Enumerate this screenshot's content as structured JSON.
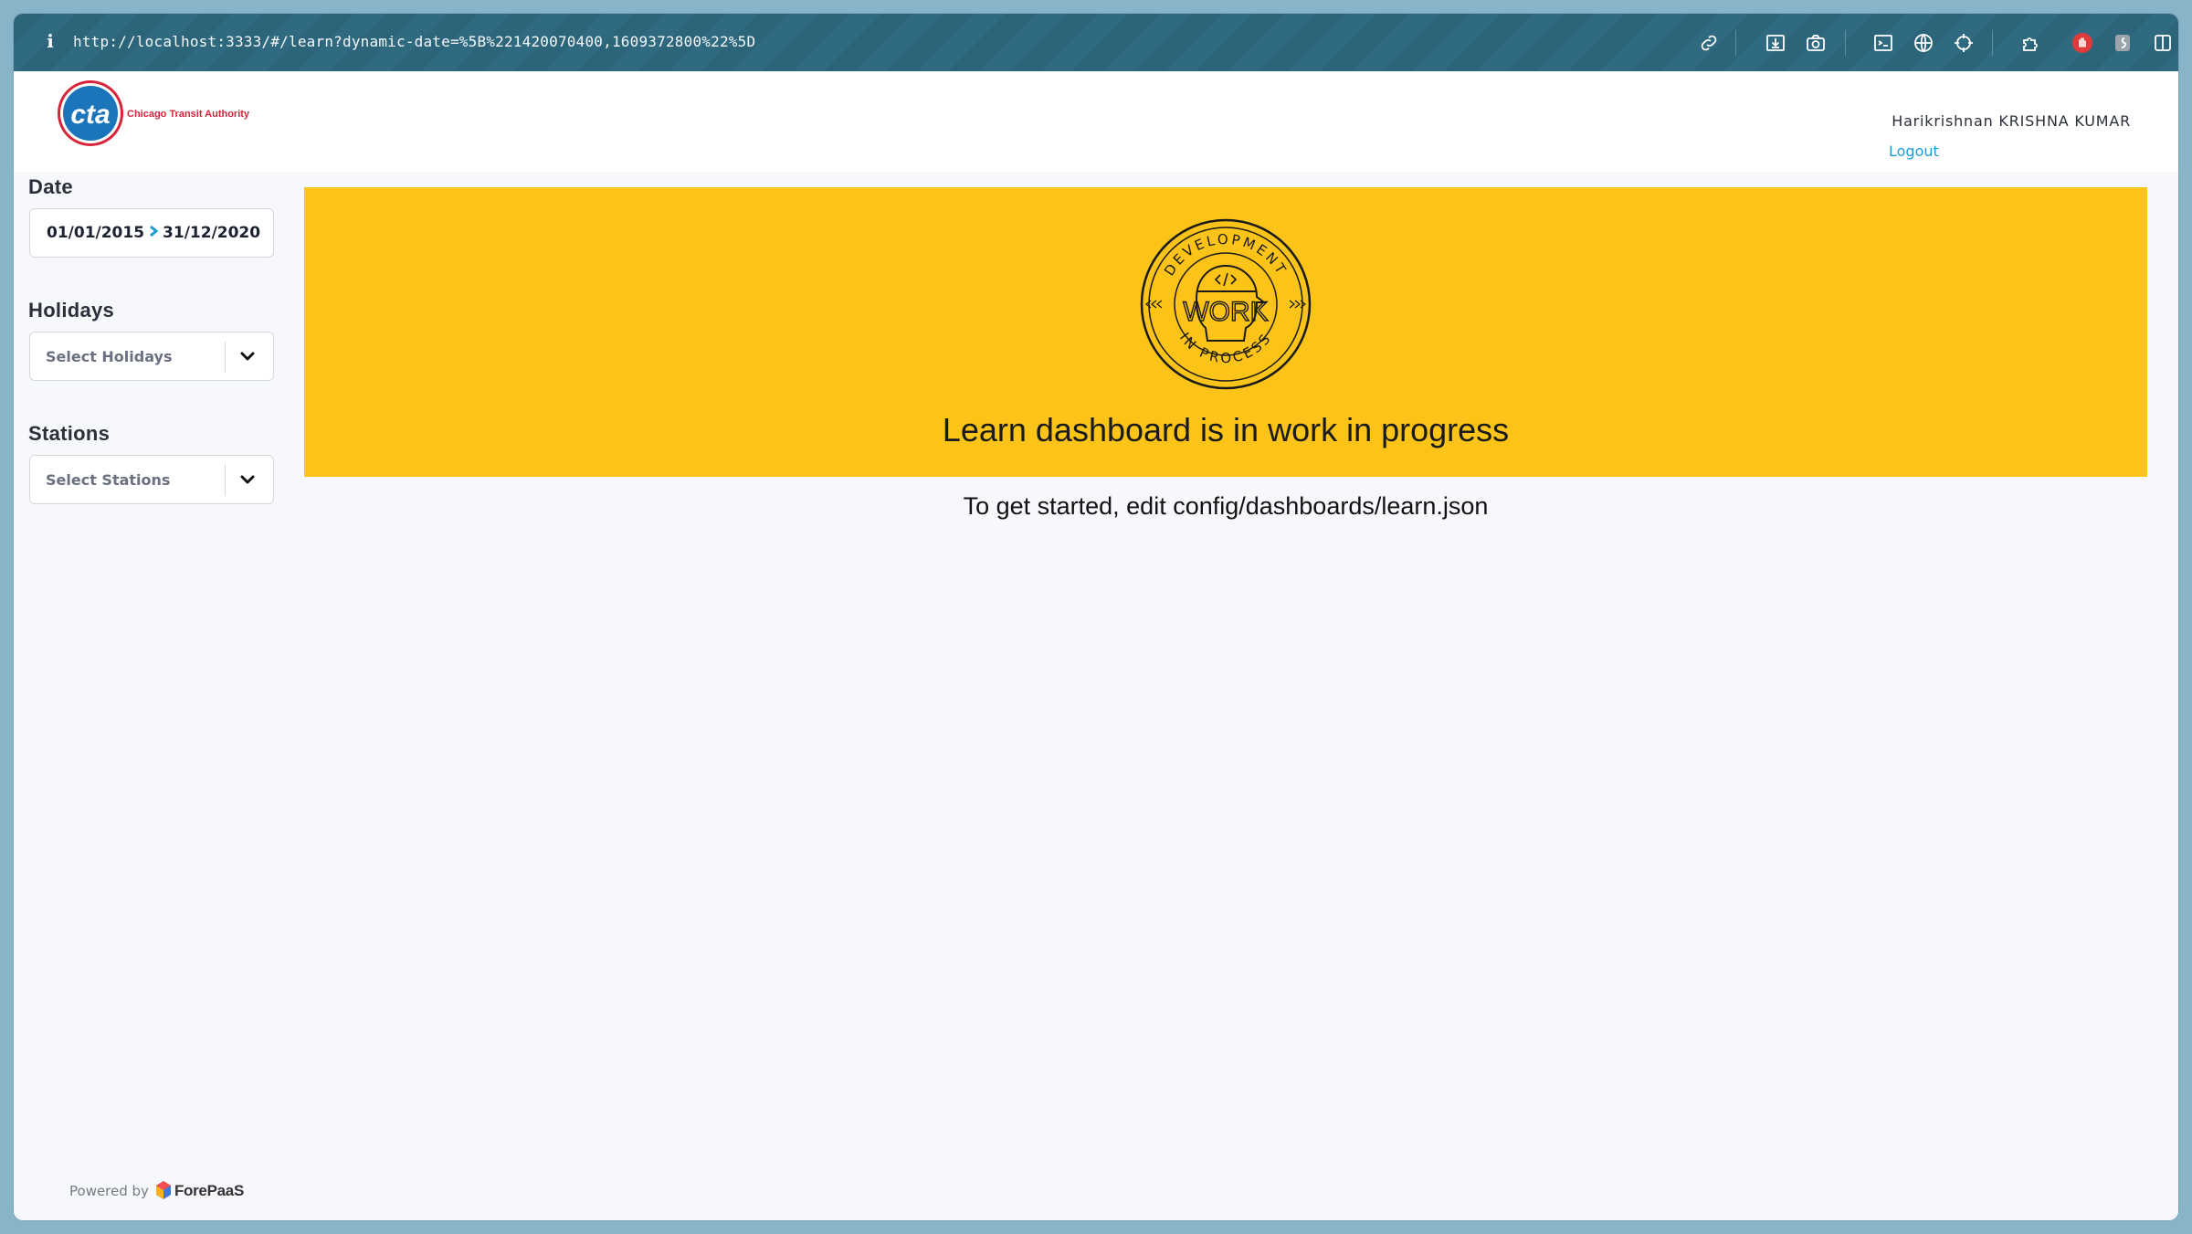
{
  "browser": {
    "url": "http://localhost:3333/#/learn?dynamic-date=%5B%221420070400,1609372800%22%5D",
    "toolbar_icons": [
      "link-icon",
      "download-icon",
      "camera-icon",
      "terminal-icon",
      "globe-icon",
      "crosshair-icon",
      "extension-icon",
      "hand-stop-icon",
      "script-icon",
      "sidebar-toggle-icon"
    ]
  },
  "header": {
    "logo_text": "cta",
    "logo_subtitle": "Chicago Transit Authority",
    "user_name": "Harikrishnan KRISHNA KUMAR",
    "logout_label": "Logout"
  },
  "sidebar": {
    "date": {
      "label": "Date",
      "start": "01/01/2015",
      "end": "31/12/2020"
    },
    "holidays": {
      "label": "Holidays",
      "placeholder": "Select Holidays"
    },
    "stations": {
      "label": "Stations",
      "placeholder": "Select Stations"
    }
  },
  "main": {
    "badge": {
      "top_text": "DEVELOPMENT",
      "center_text": "WORK",
      "bottom_text": "IN PROCESS"
    },
    "banner_title": "Learn dashboard is in work in progress",
    "subtitle": "To get started, edit config/dashboards/learn.json"
  },
  "footer": {
    "powered_by": "Powered by",
    "brand": "ForePaaS"
  },
  "colors": {
    "banner": "#fcc419",
    "accent": "#1f9bd1",
    "urlbar": "#2c6479",
    "cta_blue": "#1a75bb",
    "cta_red": "#d6243a"
  }
}
